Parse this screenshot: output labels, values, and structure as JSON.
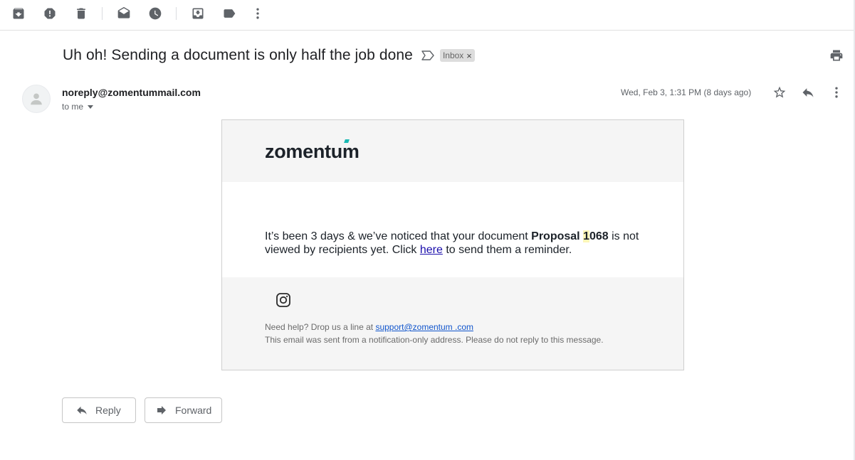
{
  "toolbar": {
    "icons": [
      "archive-icon",
      "report-spam-icon",
      "delete-icon",
      "mark-unread-icon",
      "snooze-icon",
      "move-to-icon",
      "label-icon",
      "more-icon"
    ]
  },
  "message": {
    "subject": "Uh oh! Sending a document is only half the job done",
    "label_chip": "Inbox",
    "label_remove": "×",
    "sender": "noreply@zomentummail.com",
    "recipient": "to me",
    "date": "Wed, Feb 3, 1:31 PM (8 days ago)"
  },
  "email_body": {
    "logo_text": "zomentum",
    "text_before": "It’s been 3 days & we’ve noticed that your document ",
    "doc_name_prefix": "Proposal ",
    "doc_name_highlight": "1",
    "doc_name_suffix": "068",
    "text_middle": " is not viewed by recipients yet. Click ",
    "link_text": "here",
    "text_after": " to send them a reminder.",
    "footer_help": "Need help? Drop us a line at ",
    "footer_email": "support@zomentum .com",
    "footer_notice": "This email was sent from a notification-only address. Please do not reply to this message."
  },
  "actions": {
    "reply_label": "Reply",
    "forward_label": "Forward"
  },
  "colors": {
    "accent_teal": "#19b8b2",
    "link": "#1a0dab",
    "highlight": "#fdf6b8"
  }
}
